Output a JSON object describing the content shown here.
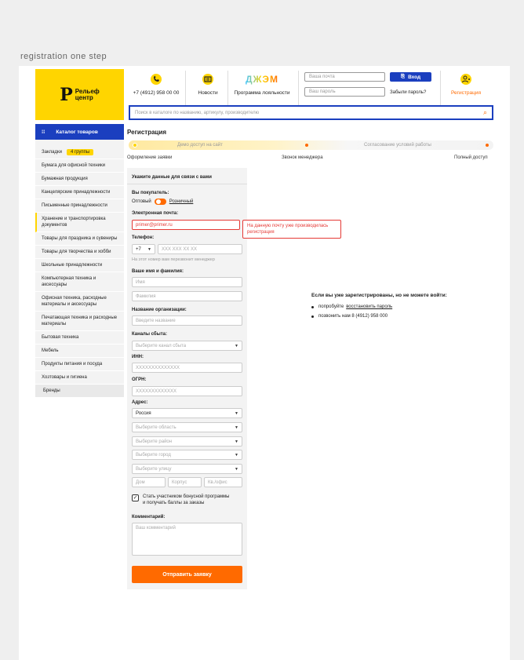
{
  "caption": "registration one step",
  "header": {
    "logo_line1": "Рельеф",
    "logo_line2": "центр",
    "phone": "+7 (4912) 958 00 00",
    "news": "Новости",
    "loyalty": "Программа лояльности",
    "loyalty_brand": "ДЖЭМ",
    "email_placeholder": "Ваша почта",
    "password_placeholder": "Ваш пароль",
    "login": "Вход",
    "forgot": "Забыли пароль?",
    "register": "Регистрация",
    "search_placeholder": "Поиск в каталоге по названию, артикулу, производителю",
    "accent": "#1b3fbf",
    "brand_yellow": "#ffd500",
    "orange": "#ff6a00"
  },
  "sidebar": {
    "catalog_button": "Каталог товаров",
    "bookmarks": "Закладки",
    "bookmarks_badge": "4 группы",
    "items": [
      "Бумага для офисной техники",
      "Бумажная продукция",
      "Канцелярские принадлежности",
      "Письменные принадлежности",
      "Хранение и транспортировка документов",
      "Товары для праздника и сувениры",
      "Товары для творчества и хобби",
      "Школьные принадлежности",
      "Компьютерная техника и аксессуары",
      "Офисная техника, расходные материалы и аксессуары",
      "Печатающая техника и расходные материалы",
      "Бытовая техника",
      "Мебель",
      "Продукты питания и посуда",
      "Хозтовары и гигиена",
      "Бренды"
    ]
  },
  "page": {
    "title": "Регистрация",
    "progress_left": "Демо доступ на сайт",
    "progress_right": "Согласование условий работы",
    "steps": [
      "Оформление заявки",
      "Звонок менеджера",
      "Полный доступ"
    ]
  },
  "form": {
    "heading": "Укажите данные для связи с вами",
    "buyer_label": "Вы покупатель:",
    "buyer_wholesale": "Оптовый",
    "buyer_retail": "Розничный",
    "email_label": "Электронная почта:",
    "email_value": "primer@primer.ru",
    "email_error": "На данную почту уже производилась регистрация",
    "phone_label": "Телефон:",
    "phone_code": "+7",
    "phone_placeholder": "XXX XXX XX XX",
    "phone_hint": "На этот номер вам перезвонит менеджер",
    "name_label": "Ваше имя и фамилия:",
    "name_placeholder": "Имя",
    "surname_placeholder": "Фамилия",
    "org_label": "Название организации:",
    "org_placeholder": "Введите название",
    "channels_label": "Каналы сбыта:",
    "channels_placeholder": "Выберите канал сбыта",
    "inn_label": "ИНН:",
    "inn_placeholder": "XXXXXXXXXXXXXX",
    "ogrn_label": "ОГРН:",
    "ogrn_placeholder": "XXXXXXXXXXXXX",
    "address_label": "Адрес:",
    "country": "Россия",
    "region_placeholder": "Выберите область",
    "district_placeholder": "Выберите район",
    "city_placeholder": "Выберите город",
    "street_placeholder": "Выберите улицу",
    "house_placeholder": "Дом",
    "building_placeholder": "Корпус",
    "apt_placeholder": "Кв./офис",
    "bonus_line1": "Стать участником бонусной программы",
    "bonus_line2": "и получать баллы за заказы",
    "comment_label": "Комментарий:",
    "comment_placeholder": "Ваш комментарий",
    "submit": "Отправить заявку"
  },
  "info": {
    "heading": "Если вы уже зарегистрированы, но не можете войти:",
    "item1_prefix": "попробуйте",
    "item1_link": "восстановить пароль",
    "item2": "позвонить нам 8 (4912) 958 000"
  }
}
